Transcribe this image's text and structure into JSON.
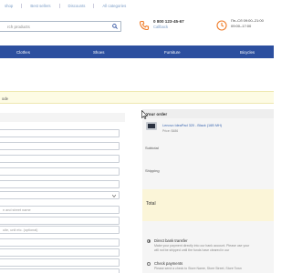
{
  "topnav": {
    "links": [
      "shop",
      "Best sellers",
      "Discounts",
      "All categories"
    ]
  },
  "search": {
    "placeholder": "rch products"
  },
  "contact": {
    "phone": "0 800 123-45-67",
    "callback": "Callback",
    "hours_days": "Пн–Сб 09:00–21:00",
    "hours_time": "09:00–17:00"
  },
  "menu": {
    "items": [
      "Clothes",
      "Shoes",
      "Furniture",
      "Bicycles"
    ]
  },
  "notice": {
    "text": "ode"
  },
  "form": {
    "fields": [
      "",
      "",
      "",
      "",
      "",
      "n and street name",
      "",
      "uite, unit etc. (optional)",
      "",
      "",
      "",
      "",
      ""
    ]
  },
  "order": {
    "title": "Your order",
    "product_name": "Lenovo IdeaPad 320 - Black (16B MH)",
    "product_price": "Price: $486",
    "subtotal_label": "Subtotal",
    "shipping_label": "Shipping",
    "total_label": "Total",
    "payments": [
      {
        "label": "Direct bank transfer",
        "desc": "Make your payment directly into our bank account. Please use your",
        "desc2": "will not be shipped until the funds have cleared in our"
      },
      {
        "label": "Check payments",
        "desc": "Please send a check to Store Name, Store Street, Store Town",
        "desc2": ""
      }
    ]
  },
  "colors": {
    "menu_bg": "#2c4f9f",
    "link": "#7a9cc6",
    "accent_orange": "#f07d2a"
  }
}
